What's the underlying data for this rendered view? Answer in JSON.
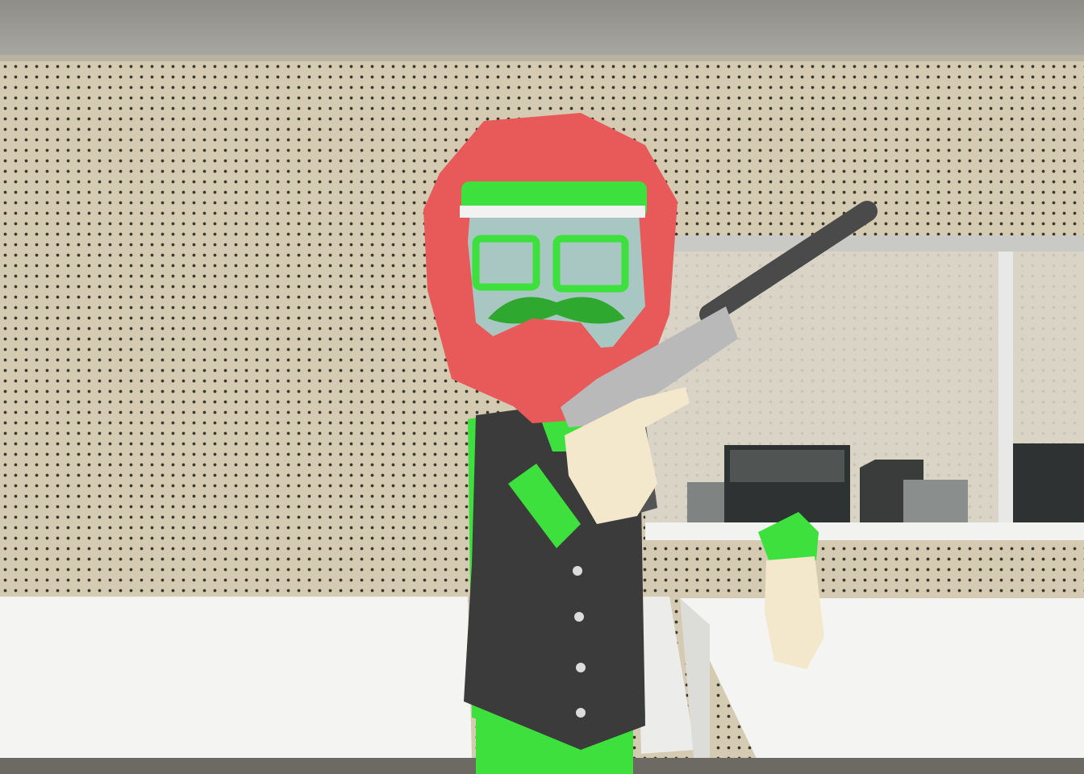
{
  "scene": {
    "type": "3d-game-view",
    "colors": {
      "wall": "#d5cbb2",
      "ceiling": "#9a978f",
      "helmet": "#e85a5a",
      "shirt": "#3de03d",
      "vest": "#3b3b3b",
      "desk": "#f4f4f2",
      "skin": "#f3e8cc",
      "gun": "#555555"
    },
    "icons": [
      "character-avatar",
      "pistol-with-suppressor",
      "computer-monitor",
      "pc-tower"
    ]
  }
}
